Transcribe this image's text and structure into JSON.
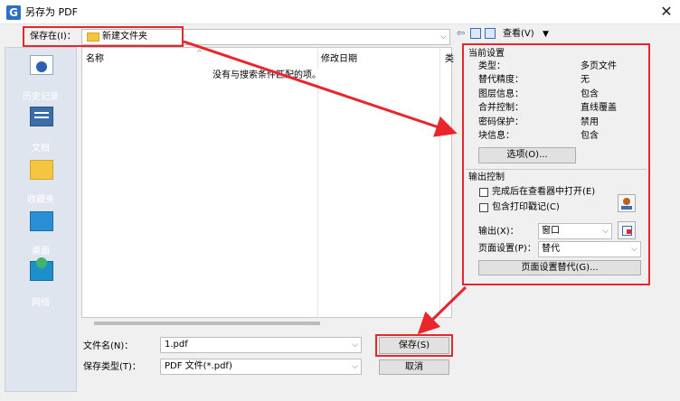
{
  "window": {
    "title": "另存为 PDF",
    "app_icon_glyph": "G",
    "close_glyph": "✕"
  },
  "top": {
    "save_in_label": "保存在(I)：",
    "save_in_value": "新建文件夹",
    "view_label": "查看(V)",
    "view_arrow": "▼"
  },
  "sidebar": {
    "items": [
      {
        "label": "历史记录",
        "icon": "history-icon"
      },
      {
        "label": "文档",
        "icon": "documents-icon"
      },
      {
        "label": "收藏夹",
        "icon": "favorites-folder-icon"
      },
      {
        "label": "桌面",
        "icon": "desktop-icon"
      },
      {
        "label": "网络",
        "icon": "network-icon"
      }
    ]
  },
  "filelist": {
    "columns": [
      "名称",
      "修改日期",
      "类"
    ],
    "empty_message": "没有与搜索条件匹配的项。"
  },
  "current_settings": {
    "header": "当前设置",
    "rows": [
      {
        "key": "类型：",
        "value": "多页文件"
      },
      {
        "key": "替代精度：",
        "value": "无"
      },
      {
        "key": "图层信息：",
        "value": "包含"
      },
      {
        "key": "合并控制：",
        "value": "直线覆盖"
      },
      {
        "key": "密码保护：",
        "value": "禁用"
      },
      {
        "key": "块信息：",
        "value": "包含"
      }
    ],
    "options_button": "选项(O)..."
  },
  "output_control": {
    "header": "输出控制",
    "open_after_label": "完成后在查看器中打开(E)",
    "stamp_label": "包含打印戳记(C)",
    "output_label": "输出(X)：",
    "output_value": "窗口",
    "page_setup_label": "页面设置(P)：",
    "page_setup_value": "替代",
    "page_override_button": "页面设置替代(G)..."
  },
  "bottom": {
    "filename_label": "文件名(N)：",
    "filename_value": "1.pdf",
    "filetype_label": "保存类型(T)：",
    "filetype_value": "PDF 文件(*.pdf)",
    "save_button": "保存(S)",
    "cancel_button": "取消"
  },
  "colors": {
    "highlight": "#e8262c",
    "accent": "#2b6fc7"
  }
}
